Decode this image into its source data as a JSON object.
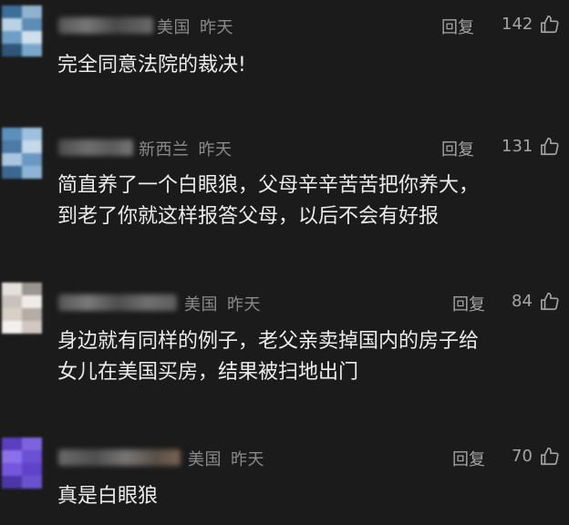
{
  "ui": {
    "reply_label": "回复",
    "like_icon": "thumbs-up-icon"
  },
  "comments": [
    {
      "location": "美国",
      "time": "昨天",
      "likes": "142",
      "lines": [
        "完全同意法院的裁决!"
      ]
    },
    {
      "location": "新西兰",
      "time": "昨天",
      "likes": "131",
      "lines": [
        "简直养了一个白眼狼，父母辛辛苦苦把你养大，",
        "到老了你就这样报答父母，以后不会有好报"
      ]
    },
    {
      "location": "美国",
      "time": "昨天",
      "likes": "84",
      "lines": [
        "身边就有同样的例子，老父亲卖掉国内的房子给",
        "女儿在美国买房，结果被扫地出门"
      ]
    },
    {
      "location": "美国",
      "time": "昨天",
      "likes": "70",
      "lines": [
        "真是白眼狼"
      ]
    }
  ]
}
